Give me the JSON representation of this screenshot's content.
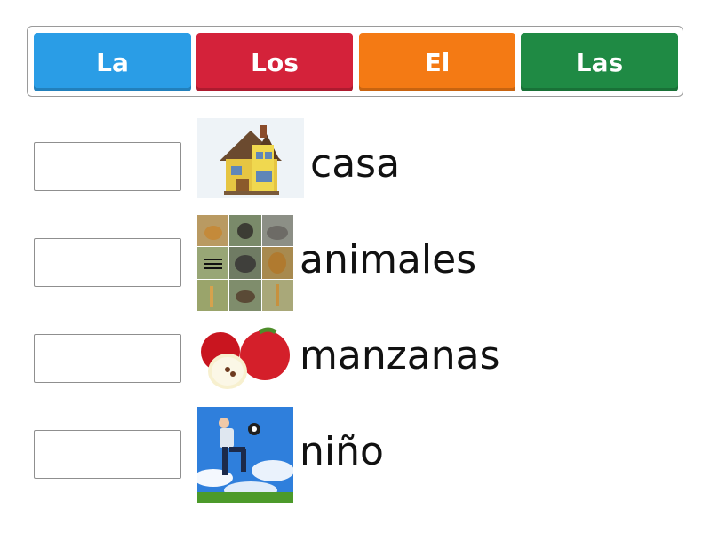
{
  "word_bank": {
    "chips": [
      {
        "label": "La",
        "color": "#2a9de6"
      },
      {
        "label": "Los",
        "color": "#d4223a"
      },
      {
        "label": "El",
        "color": "#f47a14"
      },
      {
        "label": "Las",
        "color": "#1f8a44"
      }
    ]
  },
  "items": [
    {
      "word": "casa",
      "icon": "house-icon"
    },
    {
      "word": "animales",
      "icon": "animals-collage-icon"
    },
    {
      "word": "manzanas",
      "icon": "apples-icon"
    },
    {
      "word": "niño",
      "icon": "boy-soccer-icon"
    }
  ]
}
